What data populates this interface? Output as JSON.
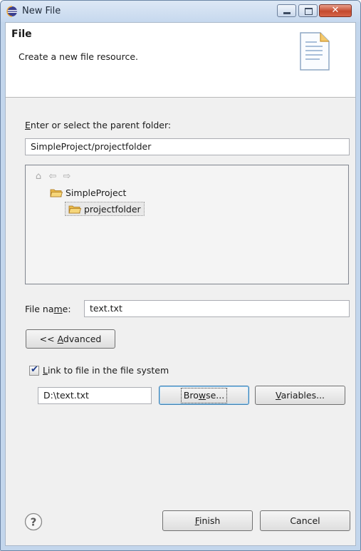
{
  "window": {
    "title": "New File",
    "minimize_glyph": "",
    "close_glyph": "✕"
  },
  "banner": {
    "title": "File",
    "description": "Create a new file resource."
  },
  "parent_folder": {
    "label_first": "E",
    "label_rest": "nter or select the parent folder:",
    "value": "SimpleProject/projectfolder"
  },
  "tree": {
    "nav": {
      "home_icon": "home-icon",
      "back_icon": "back-arrow-icon",
      "forward_icon": "forward-arrow-icon"
    },
    "items": [
      {
        "label": "SimpleProject",
        "icon": "open-folder-icon"
      },
      {
        "label": "projectfolder",
        "icon": "open-folder-icon",
        "selected": true
      }
    ]
  },
  "file_name": {
    "label_pre": "File na",
    "label_mnemonic": "m",
    "label_post": "e:",
    "value": "text.txt"
  },
  "advanced_button": {
    "pre": "<< ",
    "mnemonic": "A",
    "post": "dvanced"
  },
  "link": {
    "checked": true,
    "label_mnemonic": "L",
    "label_rest": "ink to file in the file system",
    "path_value": "D:\\text.txt"
  },
  "browse_button": {
    "pre": "Bro",
    "mnemonic": "w",
    "post": "se..."
  },
  "variables_button": {
    "mnemonic": "V",
    "post": "ariables..."
  },
  "footer": {
    "help_icon": "help-icon",
    "finish": {
      "mnemonic": "F",
      "post": "inish"
    },
    "cancel_label": "Cancel"
  },
  "colors": {
    "title_bar": "#c6d8ee",
    "close_button": "#c44a2e",
    "dialog_body": "#f0f0f0",
    "folder": "#e9b94a"
  }
}
